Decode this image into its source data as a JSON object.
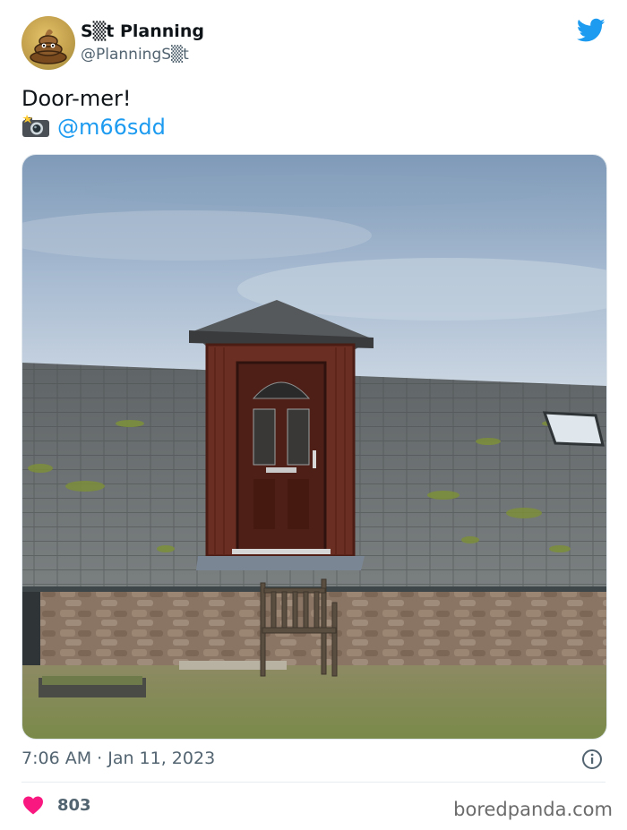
{
  "author": {
    "display_name": "S▒t Planning",
    "handle": "@PlanningS▒t",
    "avatar_icon": "poop-icon"
  },
  "platform_icon": "twitter-bird-icon",
  "tweet": {
    "text": "Door-mer!",
    "credit_icon": "camera-flash-icon",
    "credit_mention": "@m66sdd"
  },
  "photo_icon": "dormer-door-photo",
  "timestamp": "7:06 AM · Jan 11, 2023",
  "info_icon": "info-icon",
  "likes": {
    "icon": "heart-icon",
    "count": "803"
  },
  "watermark": "boredpanda.com",
  "colors": {
    "accent": "#1d9bf0",
    "like": "#f91880",
    "muted_text": "#536471"
  }
}
